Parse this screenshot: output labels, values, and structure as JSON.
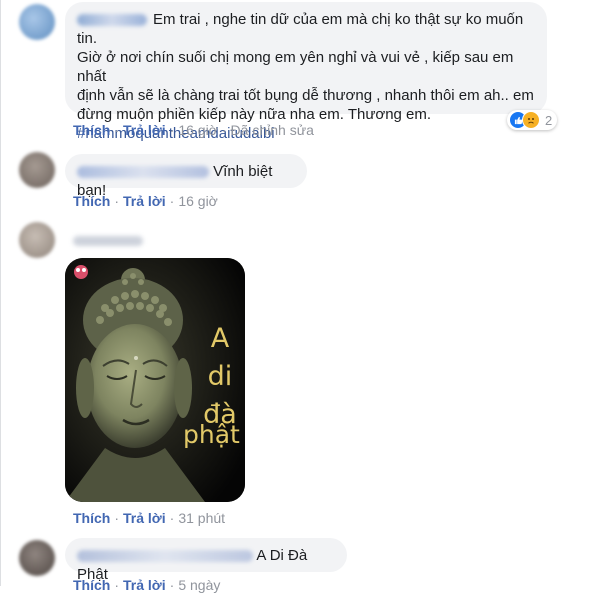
{
  "comments": [
    {
      "text_lines": [
        "Em trai , nghe tin dữ của em mà chị ko thật sự ko muốn tin.",
        "Giờ ở nơi chín suối chị mong em yên nghỉ và vui vẻ , kiếp sau em nhất",
        "định vẫn sẽ là chàng trai tốt bụng dễ thương , nhanh thôi em ah.. em",
        "đừng muộn phiền kiếp này nữa nha em. Thương em."
      ],
      "hashtag": "#nammoquantheamdaitudaibi",
      "actions": {
        "like": "Thích",
        "reply": "Trả lời",
        "time": "16 giờ",
        "edited": "Đã chỉnh sửa"
      },
      "reaction_count": "2",
      "reactions": [
        "like-icon",
        "sad-icon"
      ]
    },
    {
      "text": "Vĩnh biệt bạn!",
      "actions": {
        "like": "Thích",
        "reply": "Trả lời",
        "time": "16 giờ"
      }
    },
    {
      "image_text": [
        "A",
        "di",
        "đà",
        "phật"
      ],
      "actions": {
        "like": "Thích",
        "reply": "Trả lời",
        "time": "31 phút"
      }
    },
    {
      "text": "A Di Đà Phật",
      "actions": {
        "like": "Thích",
        "reply": "Trả lời",
        "time": "5 ngày"
      }
    }
  ],
  "colors": {
    "link": "#4267b2",
    "bubble": "#f2f3f5",
    "meta": "#90949c",
    "like": "#1877f2",
    "sad": "#f7b125"
  }
}
